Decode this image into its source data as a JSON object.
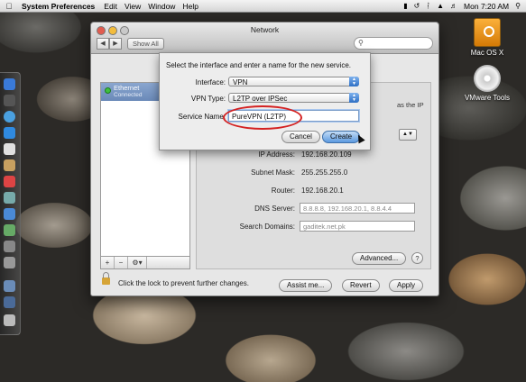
{
  "menubar": {
    "app": "System Preferences",
    "items": [
      "Edit",
      "View",
      "Window",
      "Help"
    ],
    "clock": "Mon 7:20 AM",
    "status_icons": [
      "battery-icon",
      "time-machine-icon",
      "bluetooth-icon",
      "wifi-icon",
      "volume-icon",
      "spotlight-icon"
    ]
  },
  "desktop": {
    "icons": [
      {
        "label": "Mac OS X",
        "icon": "hard-drive-icon"
      },
      {
        "label": "VMware Tools",
        "icon": "dvd-icon"
      }
    ]
  },
  "window": {
    "title": "Network",
    "show_all": "Show All",
    "services": [
      {
        "name": "Ethernet",
        "status": "Connected",
        "status_color": "#3fbf3f"
      }
    ],
    "details": {
      "behind_fragment": "as the IP",
      "ip_label": "IP Address:",
      "ip_value": "192.168.20.109",
      "subnet_label": "Subnet Mask:",
      "subnet_value": "255.255.255.0",
      "router_label": "Router:",
      "router_value": "192.168.20.1",
      "dns_label": "DNS Server:",
      "dns_value": "8.8.8.8, 192.168.20.1, 8.8.4.4",
      "domains_label": "Search Domains:",
      "domains_value": "gaditek.net.pk"
    },
    "advanced_button": "Advanced...",
    "help": "?",
    "lock_text": "Click the lock to prevent further changes.",
    "assist_button": "Assist me...",
    "revert_button": "Revert",
    "apply_button": "Apply",
    "toolbar": {
      "add": "+",
      "remove": "−",
      "action": "⚙▾"
    }
  },
  "sheet": {
    "prompt": "Select the interface and enter a name for the new service.",
    "interface_label": "Interface:",
    "interface_value": "VPN",
    "vpn_type_label": "VPN Type:",
    "vpn_type_value": "L2TP over IPSec",
    "service_name_label": "Service Name:",
    "service_name_value": "PureVPN (L2TP)",
    "cancel_button": "Cancel",
    "create_button": "Create"
  },
  "colors": {
    "selection": "#6a89b8",
    "default_button": "#5c9ae0",
    "highlight_ellipse": "#d42222"
  }
}
